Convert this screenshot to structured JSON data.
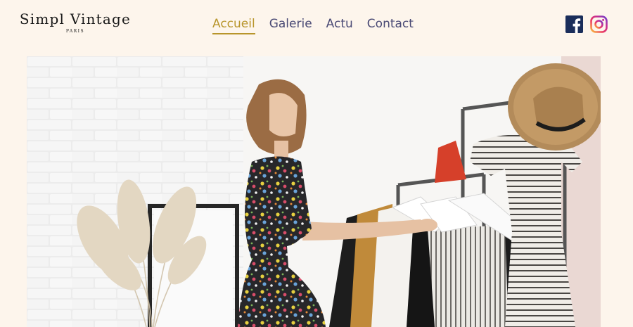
{
  "brand": {
    "name": "Simpl Vintage",
    "subtitle": "PARIS"
  },
  "nav": {
    "items": [
      {
        "label": "Accueil",
        "active": true
      },
      {
        "label": "Galerie",
        "active": false
      },
      {
        "label": "Actu",
        "active": false
      },
      {
        "label": "Contact",
        "active": false
      }
    ]
  },
  "social": {
    "facebook_icon": "facebook-icon",
    "instagram_icon": "instagram-icon"
  },
  "colors": {
    "background": "#fdf5ec",
    "nav_text": "#4a4a75",
    "nav_active": "#b8952b",
    "facebook": "#1a2d5a"
  },
  "hero": {
    "image": "woman-browsing-clothing-rack-photo"
  }
}
